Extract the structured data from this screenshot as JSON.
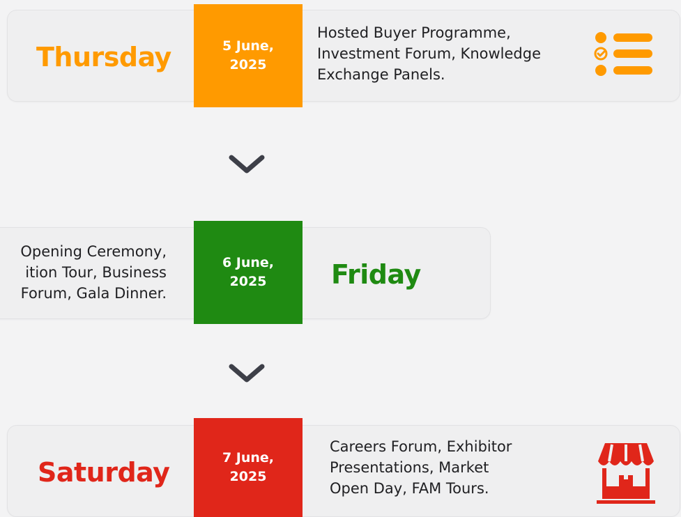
{
  "colors": {
    "thursday": "#ff9a00",
    "friday": "#1f8a12",
    "saturday": "#e0261a",
    "chevron": "#3d3f48"
  },
  "schedule": [
    {
      "day": "Thursday",
      "date": "5 June,\n2025",
      "events": "Hosted Buyer Programme,\nInvestment Forum, Knowledge\nExchange Panels.",
      "icon": "checklist-icon"
    },
    {
      "day": "Friday",
      "date": "6 June,\n2025",
      "events": "Opening Ceremony,\nition Tour, Business\nForum, Gala Dinner.",
      "icon": null
    },
    {
      "day": "Saturday",
      "date": "7 June,\n2025",
      "events": "Careers Forum, Exhibitor\nPresentations, Market\nOpen Day, FAM Tours.",
      "icon": "market-stall-icon"
    }
  ],
  "connectors": [
    "chevron-down-icon",
    "chevron-down-icon"
  ]
}
